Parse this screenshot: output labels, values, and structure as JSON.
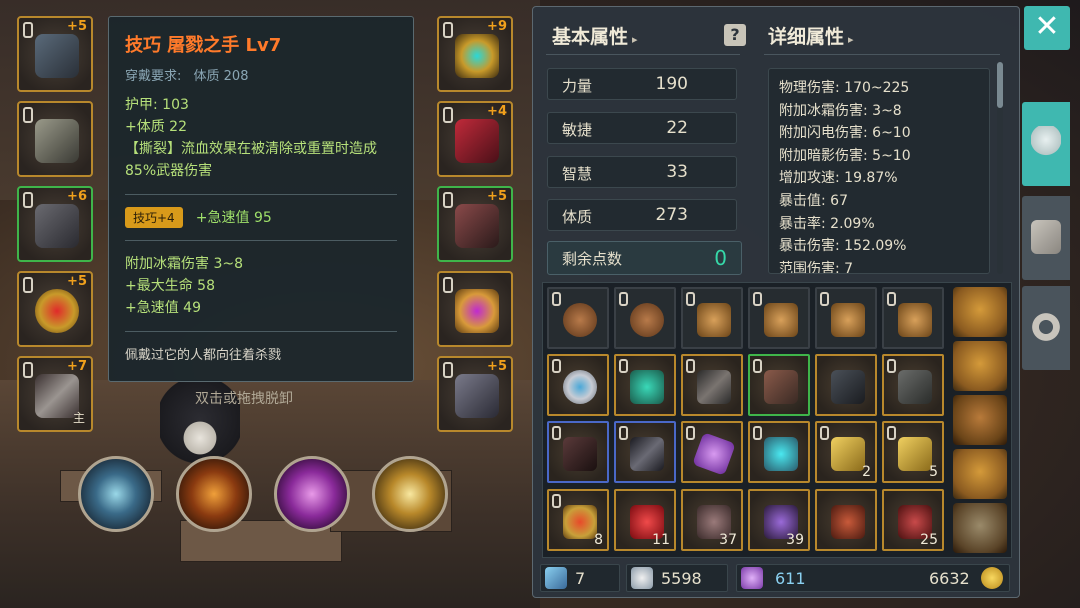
{
  "tooltip": {
    "title": "技巧 屠戮之手 Lv7",
    "requirement_label": "穿戴要求:",
    "requirement_value": "体质 208",
    "armor": "护甲: 103",
    "bonus_con": "+体质 22",
    "bleed_effect": "【撕裂】流血效果在被清除或重置时造成85%武器伤害",
    "badge": "技巧+4",
    "badge_bonus": "+急速值 95",
    "affix_1": "附加冰霜伤害 3~8",
    "affix_2": "+最大生命 58",
    "affix_3": "+急速值 49",
    "flavor": "佩戴过它的人都向往着杀戮"
  },
  "hint": "双击或拖拽脱卸",
  "equipment": {
    "left": [
      {
        "name": "helmet",
        "level": "+5",
        "tag": ""
      },
      {
        "name": "chest",
        "level": "",
        "tag": ""
      },
      {
        "name": "legs",
        "level": "+6",
        "tag": ""
      },
      {
        "name": "ring",
        "level": "+5",
        "tag": ""
      },
      {
        "name": "weapon",
        "level": "+7",
        "tag": "主"
      }
    ],
    "right": [
      {
        "name": "amulet",
        "level": "+9",
        "tag": ""
      },
      {
        "name": "gloves",
        "level": "+4",
        "tag": ""
      },
      {
        "name": "boots",
        "level": "+5",
        "tag": ""
      },
      {
        "name": "ring2",
        "level": "",
        "tag": ""
      },
      {
        "name": "offhand",
        "level": "+5",
        "tag": ""
      }
    ]
  },
  "panel": {
    "basic_title": "基本属性",
    "detail_title": "详细属性",
    "caret": "▸",
    "help": "?",
    "close": "✕",
    "stats": [
      {
        "name": "力量",
        "value": "190"
      },
      {
        "name": "敏捷",
        "value": "22"
      },
      {
        "name": "智慧",
        "value": "33"
      },
      {
        "name": "体质",
        "value": "273"
      }
    ],
    "points_label": "剩余点数",
    "points_value": "0",
    "details": [
      "物理伤害: 170~225",
      "附加冰霜伤害: 3~8",
      "附加闪电伤害: 6~10",
      "附加暗影伤害: 5~10",
      "增加攻速: 19.87%",
      "暴击值: 67",
      "暴击率: 2.09%",
      "暴击伤害: 152.09%",
      "范围伤害: 7"
    ]
  },
  "inventory": {
    "counts": {
      "r3c0": "8",
      "r3c1": "11",
      "r3c2": "37",
      "r3c3": "39",
      "r3c5": "25",
      "r2c4": "2",
      "r2c5": "5"
    }
  },
  "currency": {
    "keys": "7",
    "souls": "5598",
    "gems": "611",
    "gold": "6632"
  }
}
